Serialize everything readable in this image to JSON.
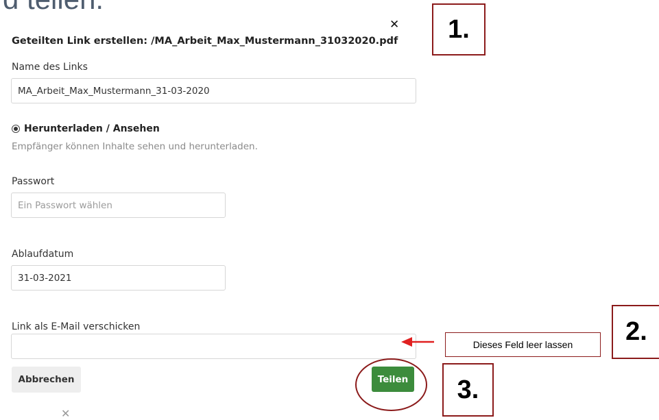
{
  "page": {
    "heading_fragment": "d teilen."
  },
  "dialog": {
    "close_symbol": "✕",
    "title": "Geteilten Link erstellen: /MA_Arbeit_Max_Mustermann_31032020.pdf",
    "link_name": {
      "label": "Name des Links",
      "value": "MA_Arbeit_Max_Mustermann_31-03-2020"
    },
    "permission": {
      "option_label": "Herunterladen / Ansehen",
      "selected": true,
      "description": "Empfänger können Inhalte sehen und herunterladen."
    },
    "password": {
      "label": "Passwort",
      "placeholder": "Ein Passwort wählen",
      "value": ""
    },
    "expiry": {
      "label": "Ablaufdatum",
      "value": "31-03-2021"
    },
    "email": {
      "label": "Link als E-Mail verschicken",
      "value": ""
    },
    "cancel_label": "Abbrechen",
    "share_label": "Teilen",
    "footer_close_symbol": "✕"
  },
  "annotations": {
    "step1": "1.",
    "step2": "2.",
    "step3": "3.",
    "note": "Dieses Feld leer lassen",
    "accent_color": "#8b1a1a",
    "arrow_color": "#e02020"
  },
  "colors": {
    "share_button": "#3c8c3c",
    "cancel_button": "#eeeeee",
    "heading": "#4f5d6f"
  }
}
